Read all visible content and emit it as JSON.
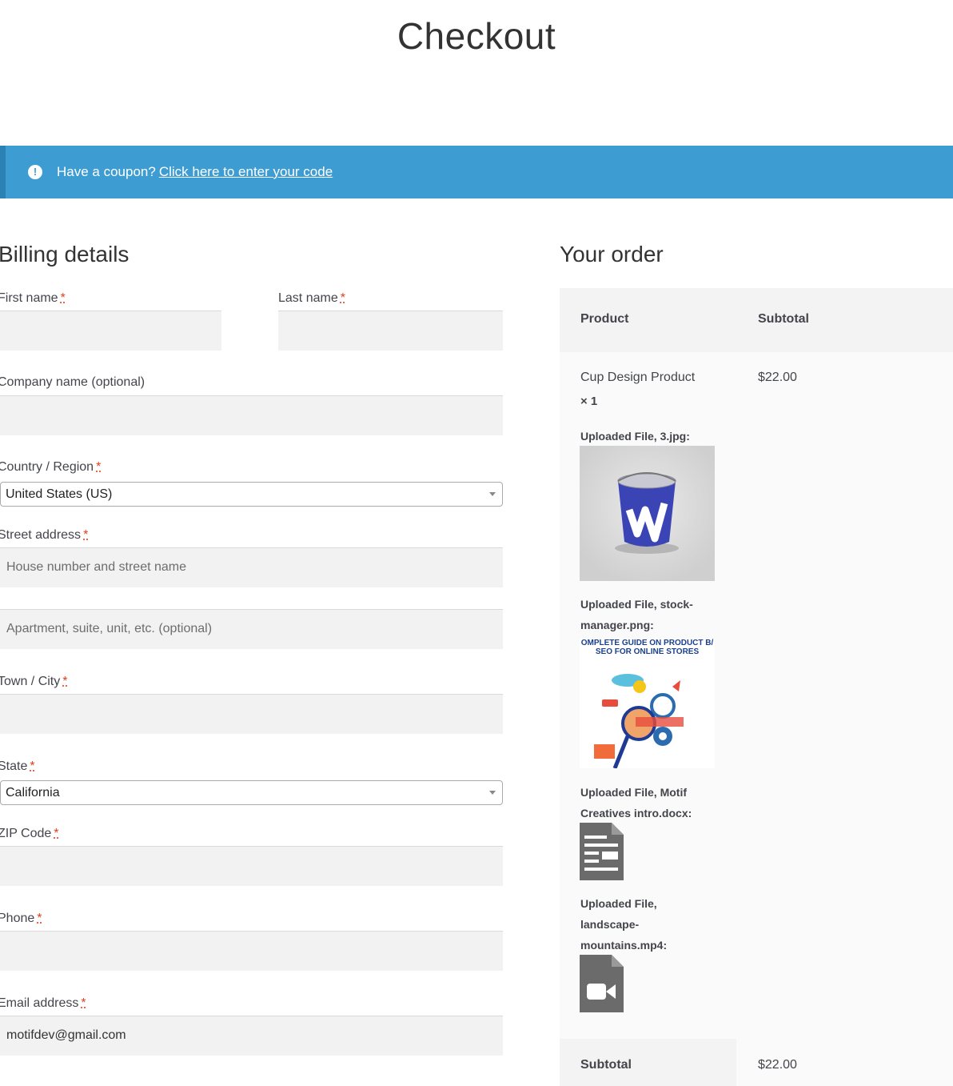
{
  "page": {
    "title": "Checkout"
  },
  "coupon": {
    "text": "Have a coupon?",
    "link": "Click here to enter your code"
  },
  "billing": {
    "title": "Billing details",
    "required_mark": "*",
    "first_name": {
      "label": "First name",
      "value": ""
    },
    "last_name": {
      "label": "Last name",
      "value": ""
    },
    "company": {
      "label": "Company name (optional)",
      "value": ""
    },
    "country": {
      "label": "Country / Region",
      "value": "United States (US)"
    },
    "street": {
      "label": "Street address",
      "placeholder1": "House number and street name",
      "placeholder2": "Apartment, suite, unit, etc. (optional)"
    },
    "city": {
      "label": "Town / City",
      "value": ""
    },
    "state": {
      "label": "State",
      "value": "California"
    },
    "zip": {
      "label": "ZIP Code",
      "value": ""
    },
    "phone": {
      "label": "Phone",
      "value": ""
    },
    "email": {
      "label": "Email address",
      "value": "motifdev@gmail.com"
    }
  },
  "order": {
    "title": "Your order",
    "col_product": "Product",
    "col_subtotal": "Subtotal",
    "item": {
      "name": "Cup Design Product",
      "qty": "× 1",
      "price": "$22.00",
      "files": [
        {
          "label": "Uploaded File, 3.jpg:"
        },
        {
          "label_line1": "Uploaded File, stock-",
          "label_line2": "manager.png:",
          "banner_line1": "OMPLETE GUIDE ON PRODUCT B/",
          "banner_line2": "SEO FOR ONLINE STORES"
        },
        {
          "label_line1": "Uploaded File, Motif",
          "label_line2": "Creatives intro.docx:"
        },
        {
          "label_line1": "Uploaded File,",
          "label_line2": "landscape-",
          "label_line3": "mountains.mp4:"
        }
      ]
    },
    "subtotal_label": "Subtotal",
    "subtotal_value": "$22.00"
  },
  "colors": {
    "notice": "#3d9cd2",
    "required": "#e2401c",
    "file_icon": "#6b6b6b",
    "paint_can": "#3a44b5"
  },
  "icons": [
    "info-icon",
    "chevron-down-icon",
    "document-icon",
    "video-icon"
  ]
}
